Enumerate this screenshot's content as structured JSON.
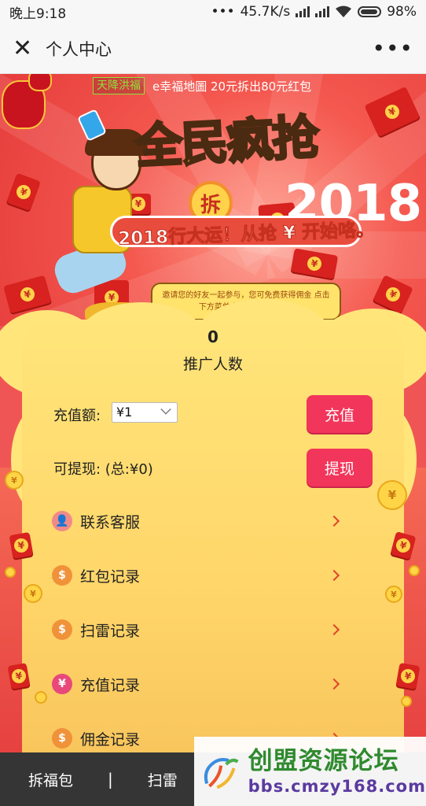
{
  "status_bar": {
    "time": "晚上9:18",
    "dots": "•••",
    "speed": "45.7K/s",
    "battery": "98%"
  },
  "top_bar": {
    "close_glyph": "✕",
    "title": "个人中心",
    "more_glyph": "•••"
  },
  "banner": {
    "notice_tag": "天降洪福",
    "notice_text": "e幸福地圖 20元拆出80元红包",
    "headline_1": "全民",
    "headline_2": "疯抢",
    "year": "2018",
    "chai": "拆",
    "slogan": "2018行大运！从抢 ¥ 开始咯。",
    "bubble": "邀请您的好友一起参与，您可免费获得佣金 点击下方菜单中“我的”即可分享"
  },
  "stats": {
    "count": "0",
    "count_label": "推广人数"
  },
  "recharge": {
    "label": "充值额:",
    "selected": "¥1",
    "button": "充值"
  },
  "withdraw": {
    "label": "可提现: (总:¥0)",
    "button": "提现"
  },
  "menu": [
    {
      "label": "联系客服",
      "icon": "user-icon",
      "glyph": "👤",
      "color": "#f08a8a"
    },
    {
      "label": "红包记录",
      "icon": "money-bag-icon",
      "glyph": "$",
      "color": "#f0923a"
    },
    {
      "label": "扫雷记录",
      "icon": "money-bag-icon",
      "glyph": "$",
      "color": "#f0923a"
    },
    {
      "label": "充值记录",
      "icon": "yen-icon",
      "glyph": "¥",
      "color": "#e8487a"
    },
    {
      "label": "佣金记录",
      "icon": "money-bag-icon",
      "glyph": "$",
      "color": "#f0923a"
    }
  ],
  "tab_bar": {
    "tab_1": "拆福包",
    "separator": "|",
    "tab_2": "扫雷"
  },
  "watermark": {
    "title": "创盟资源论坛",
    "url": "bbs.cmzy168.com"
  }
}
